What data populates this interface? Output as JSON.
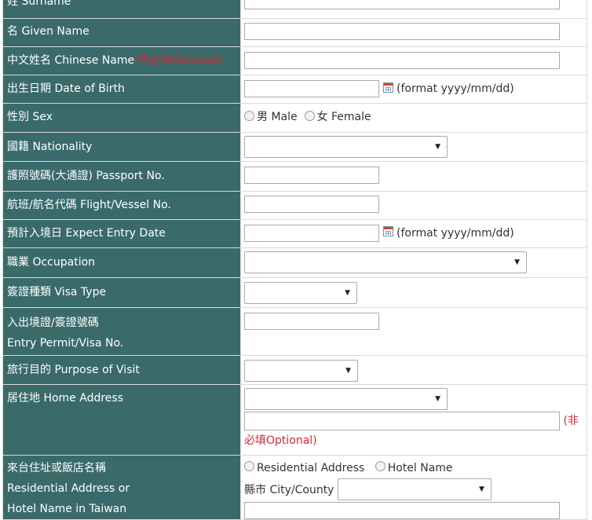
{
  "rows": {
    "surname": {
      "label": "姓 Surname"
    },
    "given_name": {
      "label": "名 Given Name"
    },
    "chinese_name": {
      "label": "中文姓名 Chinese Name",
      "optional": "(非必填Optional)"
    },
    "dob": {
      "label": "出生日期 Date of Birth",
      "format": "(format yyyy/mm/dd)"
    },
    "sex": {
      "label": "性別 Sex",
      "male": "男 Male",
      "female": "女 Female"
    },
    "nationality": {
      "label": "國籍 Nationality",
      "value": ""
    },
    "passport": {
      "label": "護照號碼(大通證) Passport No."
    },
    "flight": {
      "label": "航班/航名代碼 Flight/Vessel No."
    },
    "entry_date": {
      "label": "預計入境日 Expect Entry Date",
      "format": "(format yyyy/mm/dd)"
    },
    "occupation": {
      "label": "職業 Occupation",
      "value": ""
    },
    "visa_type": {
      "label": "簽證種類 Visa Type",
      "value": ""
    },
    "permit": {
      "label_line1": "入出境證/簽證號碼",
      "label_line2": "Entry Permit/Visa No."
    },
    "purpose": {
      "label": "旅行目的 Purpose of Visit",
      "value": ""
    },
    "home_address": {
      "label": "居住地 Home Address",
      "optional_a": "(非",
      "optional_b": "必填Optional)"
    },
    "taiwan_address": {
      "label_line1": "來台住址或飯店名稱",
      "label_line2": "Residential Address or",
      "label_line3": "Hotel Name in Taiwan",
      "residential": "Residential Address",
      "hotel": "Hotel Name",
      "city_label": "縣市 City/County"
    }
  }
}
